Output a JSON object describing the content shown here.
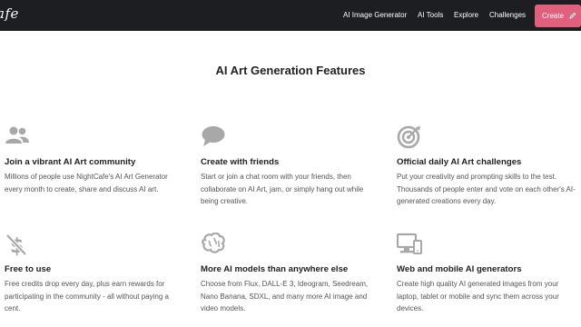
{
  "header": {
    "logo": "afe",
    "nav": [
      "AI Image Generator",
      "AI Tools",
      "Explore",
      "Challenges"
    ],
    "create_label": "Create"
  },
  "section_title": "AI Art Generation Features",
  "features": [
    {
      "icon": "users-icon",
      "title": "Join a vibrant AI Art community",
      "desc": "Millions of people use NightCafe's AI Art Generator every month to create, share and discuss AI art."
    },
    {
      "icon": "chat-bubble-icon",
      "title": "Create with friends",
      "desc": "Start or join a chat room with your friends, then collaborate on AI Art, jam, or simply hang out while being creative."
    },
    {
      "icon": "target-icon",
      "title": "Official daily AI Art challenges",
      "desc": "Put your creativity and prompting skills to the test. Thousands of people enter and vote on each other's AI-generated creations every day."
    },
    {
      "icon": "no-dollar-icon",
      "title": "Free to use",
      "desc": "Free credits drop every day, plus earn rewards for participating in the community - all without paying a cent."
    },
    {
      "icon": "brain-icon",
      "title": "More AI models than anywhere else",
      "desc": "Choose from Flux, DALL-E 3, Ideogram, Seedream, Nano Banana, SDXL, and many more AI image and video models."
    },
    {
      "icon": "devices-icon",
      "title": "Web and mobile AI generators",
      "desc": "Create high quality AI generated images from your laptop, tablet or mobile and sync them across your devices."
    }
  ],
  "colors": {
    "topbar": "#1d1e22",
    "accent": "#e0607e",
    "icon": "#a8a8a8",
    "heading": "#222222",
    "body_text": "#555555"
  }
}
